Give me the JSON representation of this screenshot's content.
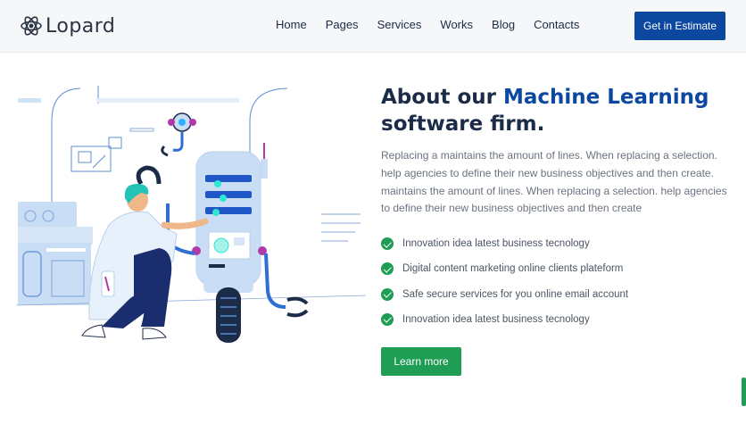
{
  "brand": {
    "name": "Lopard",
    "logo_icon": "atom-icon"
  },
  "nav": {
    "links": [
      "Home",
      "Pages",
      "Services",
      "Works",
      "Blog",
      "Contacts"
    ],
    "cta_label": "Get in Estimate"
  },
  "about": {
    "headline_part1": "About our ",
    "headline_accent": "Machine Learning",
    "headline_part2": "software firm.",
    "paragraph": "Replacing a maintains the amount of lines. When replacing a selection. help agencies to define their new business objectives and then create. maintains the amount of lines. When replacing a selection. help agencies to define their new business objectives and then create",
    "features": [
      "Innovation idea latest business tecnology",
      "Digital content marketing online clients plateform",
      "Safe secure services for you online email account",
      "Innovation idea latest business tecnology"
    ],
    "button_label": "Learn more",
    "illustration": "engineer-repairing-robot-illustration"
  },
  "colors": {
    "brand_blue": "#0c47a0",
    "success_green": "#1f9d55",
    "text_dark": "#1c2b47",
    "text_muted": "#6b7380",
    "navbar_bg": "#f6f7f9"
  }
}
